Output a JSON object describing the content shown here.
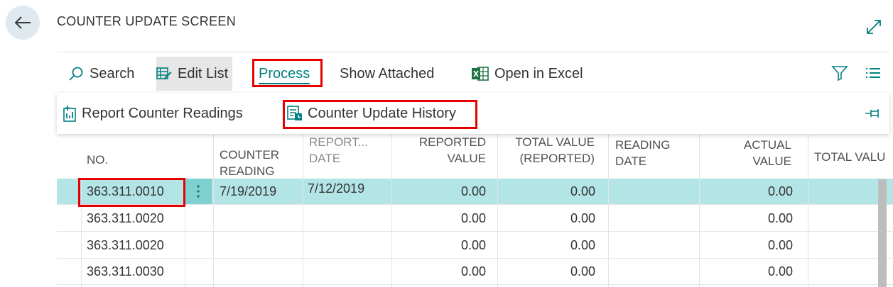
{
  "page": {
    "title": "COUNTER UPDATE SCREEN"
  },
  "actions": {
    "search": "Search",
    "edit_list": "Edit List",
    "process": "Process",
    "show_attached": "Show Attached",
    "open_in_excel": "Open in Excel"
  },
  "process_menu": {
    "report_counter_readings": "Report Counter Readings",
    "counter_update_history": "Counter Update History"
  },
  "columns": {
    "no": "NO.",
    "counter_reading": "COUNTER READING",
    "reported_date": "REPORT... DATE",
    "reported_value": "REPORTED VALUE",
    "total_value_reported": "TOTAL VALUE (REPORTED)",
    "reading_date": "READING DATE",
    "actual_value": "ACTUAL VALUE",
    "total_value": "TOTAL VALU"
  },
  "rows": [
    {
      "no": "363.311.0010",
      "counter_reading": "7/19/2019",
      "reported_date": "7/12/2019",
      "reported_value": "0.00",
      "total_value_reported": "0.00",
      "reading_date": "",
      "actual_value": "0.00"
    },
    {
      "no": "363.311.0020",
      "counter_reading": "",
      "reported_date": "",
      "reported_value": "0.00",
      "total_value_reported": "0.00",
      "reading_date": "",
      "actual_value": "0.00"
    },
    {
      "no": "363.311.0020",
      "counter_reading": "",
      "reported_date": "",
      "reported_value": "0.00",
      "total_value_reported": "0.00",
      "reading_date": "",
      "actual_value": "0.00"
    },
    {
      "no": "363.311.0030",
      "counter_reading": "",
      "reported_date": "",
      "reported_value": "0.00",
      "total_value_reported": "0.00",
      "reading_date": "",
      "actual_value": "0.00"
    }
  ],
  "colors": {
    "accent": "#00807f",
    "selected_row": "#b3e5e6",
    "highlight": "#e60000",
    "excel": "#1e7145"
  },
  "icons": [
    "back-arrow-icon",
    "expand-icon",
    "search-icon",
    "edit-list-icon",
    "excel-icon",
    "filter-icon",
    "list-view-icon",
    "report-icon",
    "history-icon",
    "pin-icon",
    "more-options-icon"
  ]
}
